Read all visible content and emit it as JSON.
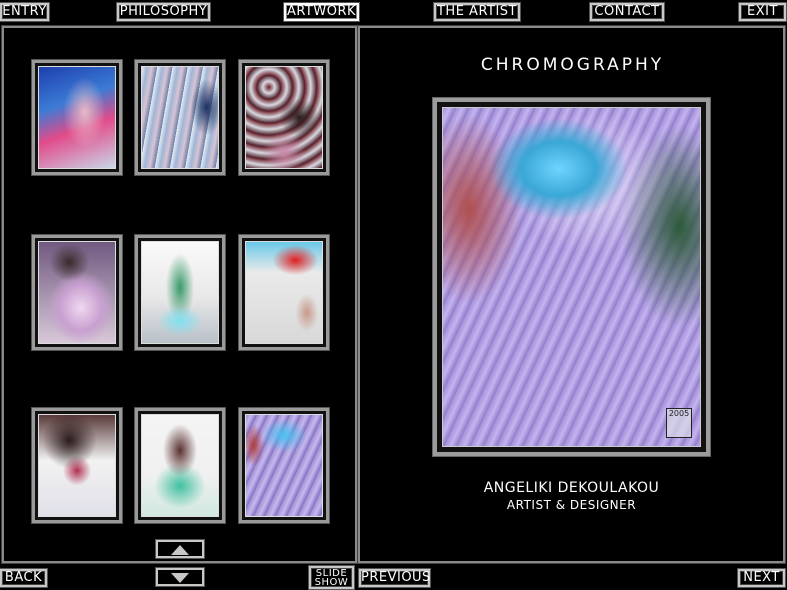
{
  "nav": {
    "entry": "ENTRY",
    "philosophy": "PHILOSOPHY",
    "artwork": "ARTWORK",
    "the_artist": "THE ARTIST",
    "contact": "CONTACT",
    "exit": "EXIT"
  },
  "gallery": {
    "title": "CHROMOGRAPHY",
    "slideshow_line1": "SLIDE",
    "slideshow_line2": "SHOW",
    "up_icon": "arrow-up-icon",
    "down_icon": "arrow-down-icon"
  },
  "viewer": {
    "artist_name": "ANGELIKI DEKOULAKOU",
    "artist_role": "ARTIST & DESIGNER",
    "signature_year": "2005"
  },
  "footer": {
    "back": "BACK",
    "previous": "PREVIOUS",
    "next": "NEXT"
  },
  "colors": {
    "background": "#000000",
    "border": "#9a9a9a",
    "text": "#ffffff"
  }
}
